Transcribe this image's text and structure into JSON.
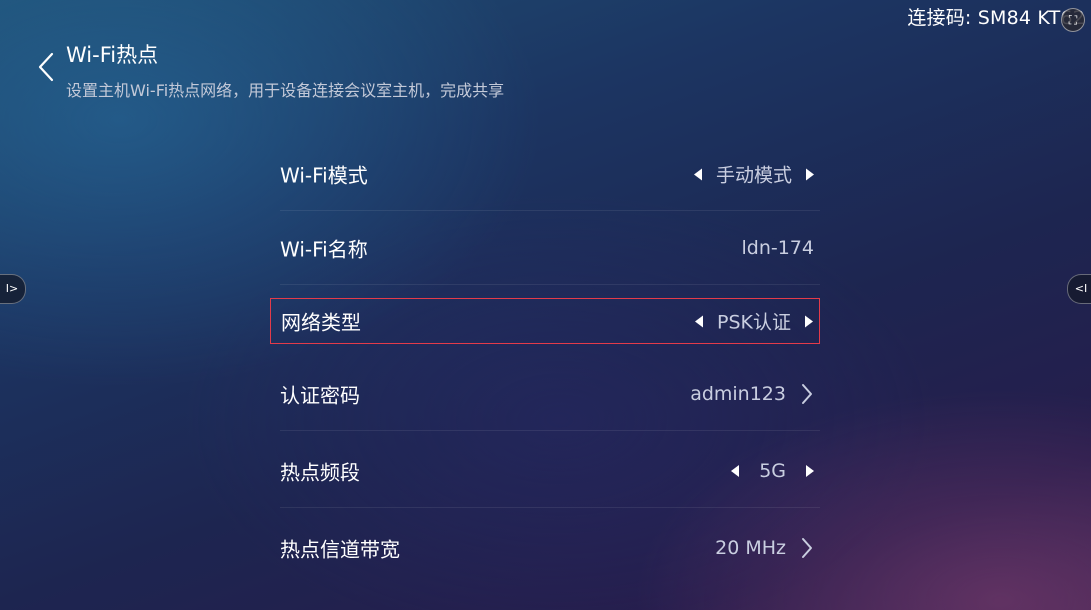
{
  "connection": {
    "label": "连接码: SM84 KT62",
    "icon": "expand-icon"
  },
  "header": {
    "title": "Wi-Fi热点",
    "subtitle": "设置主机Wi-Fi热点网络，用于设备连接会议室主机，完成共享",
    "back_icon": "chevron-left-icon"
  },
  "side_tabs": {
    "left_label": "I>",
    "right_label": "<I"
  },
  "settings": [
    {
      "label": "Wi-Fi模式",
      "value": "手动模式",
      "control": "selector"
    },
    {
      "label": "Wi-Fi名称",
      "value": "ldn-174",
      "control": "text"
    },
    {
      "label": "网络类型",
      "value": "PSK认证",
      "control": "selector",
      "focused": true
    },
    {
      "label": "认证密码",
      "value": "admin123",
      "control": "link"
    },
    {
      "label": "热点频段",
      "value": "5G",
      "control": "selector"
    },
    {
      "label": "热点信道带宽",
      "value": "20 MHz",
      "control": "link"
    }
  ],
  "colors": {
    "focus_border": "#e33b4a",
    "value_text": "#c9cee0"
  }
}
